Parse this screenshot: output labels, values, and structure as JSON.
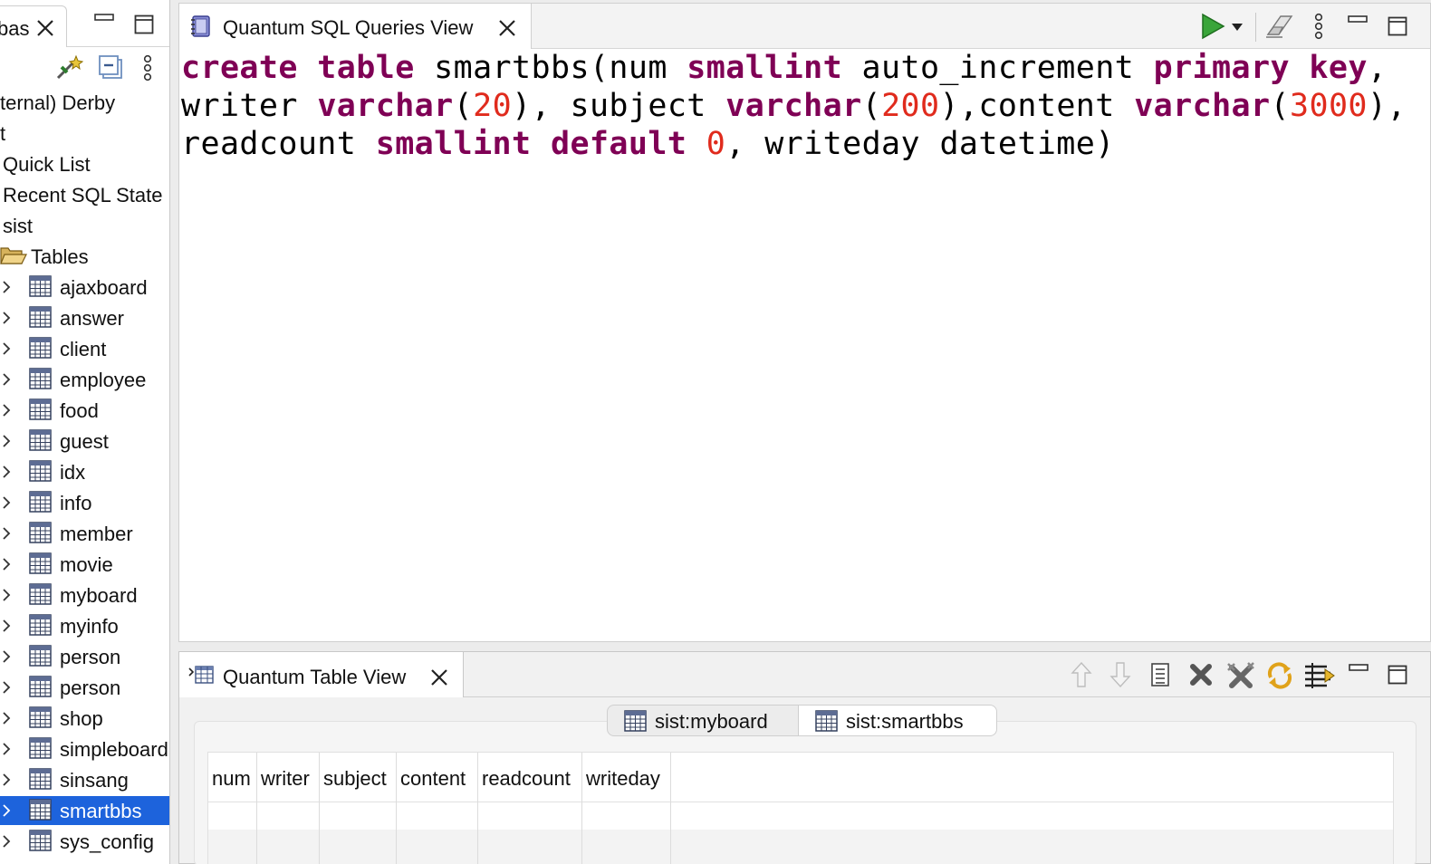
{
  "left_panel": {
    "tab_label": "bas",
    "tree": {
      "items": [
        {
          "label": "ternal) Derby",
          "kind": "text"
        },
        {
          "label": "t",
          "kind": "text"
        },
        {
          "label": "Quick List",
          "kind": "text"
        },
        {
          "label": "Recent SQL State",
          "kind": "text"
        },
        {
          "label": "sist",
          "kind": "text"
        },
        {
          "label": "Tables",
          "kind": "folder"
        }
      ],
      "tables": [
        "ajaxboard",
        "answer",
        "client",
        "employee",
        "food",
        "guest",
        "idx",
        "info",
        "member",
        "movie",
        "myboard",
        "myinfo",
        "person",
        "person",
        "shop",
        "simpleboard",
        "sinsang",
        "smartbbs",
        "sys_config"
      ],
      "selected_table": "smartbbs"
    }
  },
  "editor": {
    "tab_label": "Quantum SQL Queries View",
    "sql_lines": [
      [
        {
          "t": "create table",
          "c": "kw"
        },
        {
          "t": " smartbbs(num ",
          "c": ""
        },
        {
          "t": "smallint",
          "c": "kw"
        },
        {
          "t": " auto_increment ",
          "c": ""
        },
        {
          "t": "primary key",
          "c": "kw"
        },
        {
          "t": ",",
          "c": ""
        }
      ],
      [
        {
          "t": "writer ",
          "c": ""
        },
        {
          "t": "varchar",
          "c": "kw"
        },
        {
          "t": "(",
          "c": ""
        },
        {
          "t": "20",
          "c": "num"
        },
        {
          "t": "), subject ",
          "c": ""
        },
        {
          "t": "varchar",
          "c": "kw"
        },
        {
          "t": "(",
          "c": ""
        },
        {
          "t": "200",
          "c": "num"
        },
        {
          "t": "),content ",
          "c": ""
        },
        {
          "t": "varchar",
          "c": "kw"
        },
        {
          "t": "(",
          "c": ""
        },
        {
          "t": "3000",
          "c": "num"
        },
        {
          "t": "),",
          "c": ""
        }
      ],
      [
        {
          "t": "readcount ",
          "c": ""
        },
        {
          "t": "smallint",
          "c": "kw"
        },
        {
          "t": " ",
          "c": ""
        },
        {
          "t": "default",
          "c": "kw"
        },
        {
          "t": " ",
          "c": ""
        },
        {
          "t": "0",
          "c": "num"
        },
        {
          "t": ", writeday datetime)",
          "c": ""
        }
      ]
    ]
  },
  "table_view": {
    "tab_label": "Quantum Table View",
    "tabs": [
      "sist:myboard",
      "sist:smartbbs"
    ],
    "active_tab": "sist:smartbbs",
    "columns": [
      "num",
      "writer",
      "subject",
      "content",
      "readcount",
      "writeday"
    ]
  },
  "colors": {
    "keyword": "#7f0055",
    "number": "#e02b1d",
    "selection": "#1d63dc",
    "run_green": "#2f9e2f"
  }
}
